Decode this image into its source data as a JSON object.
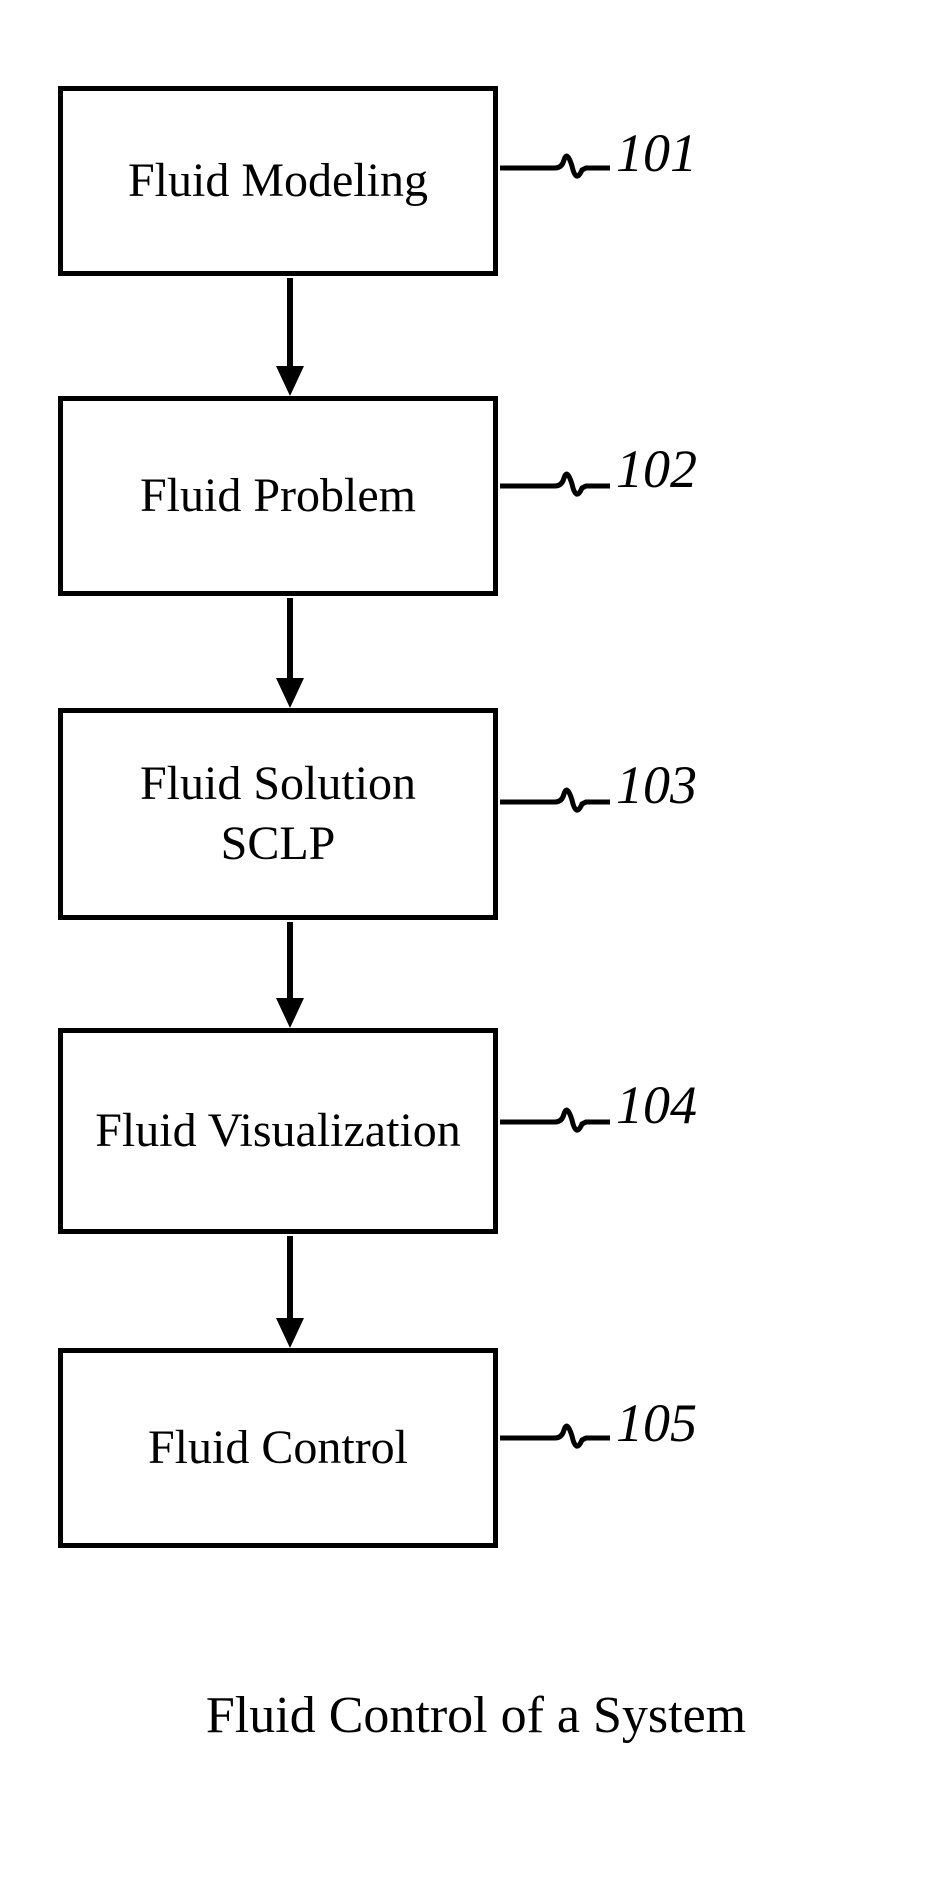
{
  "flowchart": {
    "boxes": [
      {
        "id": "101",
        "text": "Fluid Modeling"
      },
      {
        "id": "102",
        "text": "Fluid Problem"
      },
      {
        "id": "103",
        "text": "Fluid Solution\nSCLP"
      },
      {
        "id": "104",
        "text": "Fluid Visualization"
      },
      {
        "id": "105",
        "text": "Fluid Control"
      }
    ],
    "labels": {
      "l101": "101",
      "l102": "102",
      "l103": "103",
      "l104": "104",
      "l105": "105"
    },
    "caption": "Fluid Control of a System"
  }
}
